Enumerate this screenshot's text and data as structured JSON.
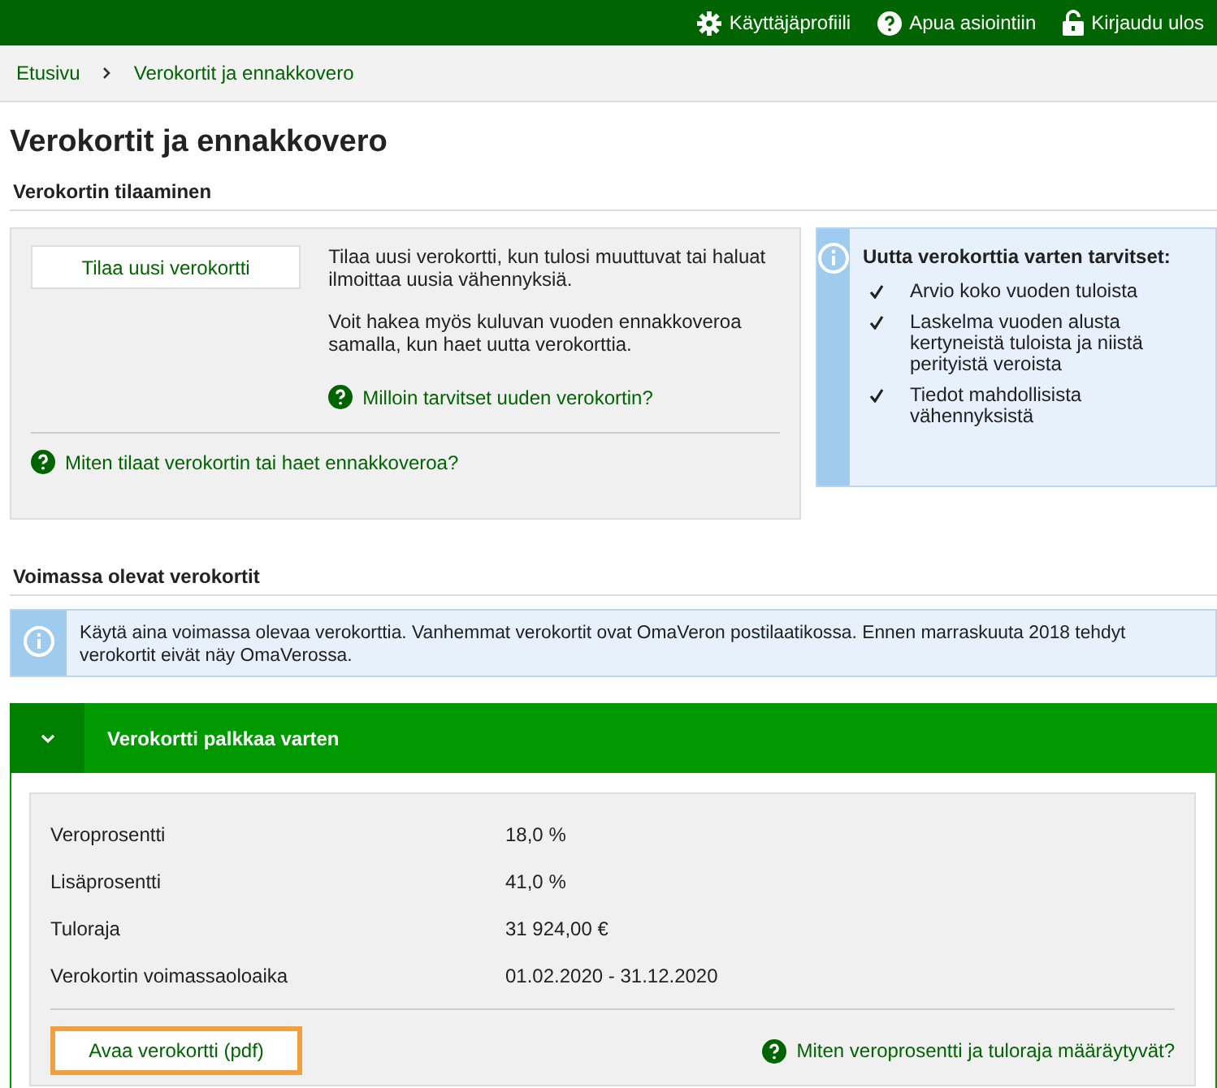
{
  "top_nav": [
    {
      "kind": "gear",
      "label": "Käyttäjäprofiili"
    },
    {
      "kind": "help",
      "label": "Apua asiointiin"
    },
    {
      "kind": "lock",
      "label": "Kirjaudu ulos"
    }
  ],
  "breadcrumb": [
    "Etusivu",
    "Verokortit ja ennakkovero"
  ],
  "page_title": "Verokortit ja ennakkovero",
  "order_section": {
    "heading": "Verokortin tilaaminen",
    "button": "Tilaa uusi verokortti",
    "paragraphs": [
      "Tilaa uusi verokortti, kun tulosi muuttuvat tai haluat ilmoittaa uusia vähennyksiä.",
      "Voit hakea myös kuluvan vuoden ennakkoveroa samalla, kun haet uutta verokorttia."
    ],
    "inner_link": "Milloin tarvitset uuden verokortin?",
    "footer_link": "Miten tilaat verokortin tai haet ennakkoveroa?"
  },
  "needs_box": {
    "title": "Uutta verokorttia varten tarvitset:",
    "items": [
      "Arvio koko vuoden tuloista",
      "Laskelma vuoden alusta kertyneistä tuloista ja niistä perityistä veroista",
      "Tiedot mahdollisista vähennyksistä"
    ]
  },
  "valid_section": {
    "heading": "Voimassa olevat verokortit",
    "notice": "Käytä aina voimassa olevaa verokorttia. Vanhemmat verokortit ovat OmaVeron postilaatikossa. Ennen marraskuuta 2018 tehdyt verokortit eivät näy OmaVerossa."
  },
  "accordion": {
    "title": "Verokortti palkkaa varten",
    "expanded": true,
    "rows": [
      {
        "label": "Veroprosentti",
        "value": "18,0 %"
      },
      {
        "label": "Lisäprosentti",
        "value": "41,0 %"
      },
      {
        "label": "Tuloraja",
        "value": "31 924,00 €"
      },
      {
        "label": "Verokortin voimassaoloaika",
        "value": "01.02.2020 - 31.12.2020"
      }
    ],
    "button": {
      "label": "Avaa verokortti (pdf)",
      "highlighted": true
    },
    "help_link": "Miten veroprosentti ja tuloraja määräytyvät?"
  }
}
